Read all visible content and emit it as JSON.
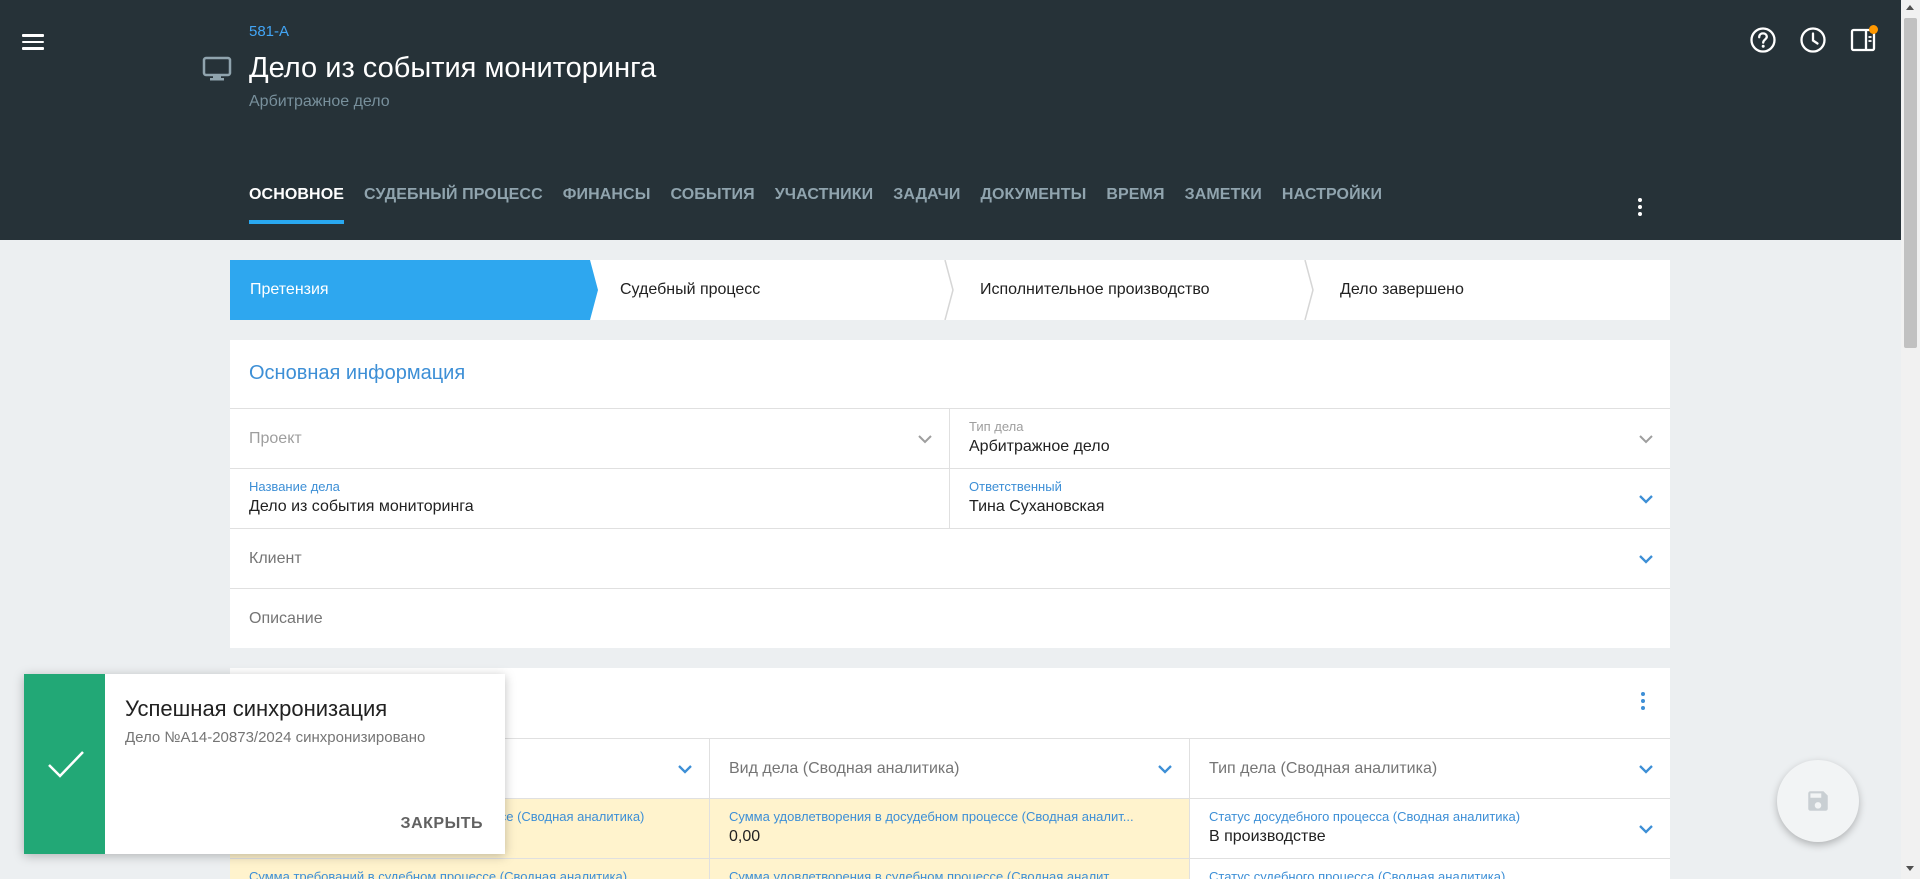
{
  "header": {
    "case_number": "581-А",
    "title": "Дело из события мониторинга",
    "subtitle": "Арбитражное дело"
  },
  "tabs": [
    {
      "label": "ОСНОВНОЕ",
      "active": true
    },
    {
      "label": "СУДЕБНЫЙ ПРОЦЕСС",
      "active": false
    },
    {
      "label": "ФИНАНСЫ",
      "active": false
    },
    {
      "label": "СОБЫТИЯ",
      "active": false
    },
    {
      "label": "УЧАСТНИКИ",
      "active": false
    },
    {
      "label": "ЗАДАЧИ",
      "active": false
    },
    {
      "label": "ДОКУМЕНТЫ",
      "active": false
    },
    {
      "label": "ВРЕМЯ",
      "active": false
    },
    {
      "label": "ЗАМЕТКИ",
      "active": false
    },
    {
      "label": "НАСТРОЙКИ",
      "active": false
    }
  ],
  "stepper": {
    "steps": [
      "Претензия",
      "Судебный процесс",
      "Исполнительное производство",
      "Дело завершено"
    ],
    "active_index": 0
  },
  "main_info": {
    "title": "Основная информация",
    "project_placeholder": "Проект",
    "case_type_label": "Тип дела",
    "case_type_value": "Арбитражное дело",
    "case_name_label": "Название дела",
    "case_name_value": "Дело из события мониторинга",
    "responsible_label": "Ответственный",
    "responsible_value": "Тина Сухановская",
    "client_placeholder": "Клиент",
    "description_placeholder": "Описание"
  },
  "analytics": {
    "row1": {
      "col2_placeholder": "Вид дела (Сводная аналитика)",
      "col3_placeholder": "Тип дела (Сводная аналитика)"
    },
    "row2": {
      "col1_label_partial": "ессе (Сводная аналитика)",
      "col2_label": "Сумма удовлетворения в досудебном процессе (Сводная аналит...",
      "col2_value": "0,00",
      "col3_label": "Статус досудебного процесса (Сводная аналитика)",
      "col3_value": "В производстве"
    },
    "row3": {
      "col1_label": "Сумма требований в судебном процессе (Сводная аналитика)",
      "col2_label": "Сумма удовлетворения в судебном процессе (Сводная аналит...",
      "col3_label": "Статус судебного процесса (Сводная аналитика)"
    }
  },
  "toast": {
    "title": "Успешная синхронизация",
    "text": "Дело №А14-20873/2024 синхронизировано",
    "close_label": "ЗАКРЫТЬ"
  },
  "colors": {
    "header_bg": "#263238",
    "accent": "#2ea7ef",
    "toast_success": "#22a876",
    "highlight_row": "#fff3cd"
  }
}
